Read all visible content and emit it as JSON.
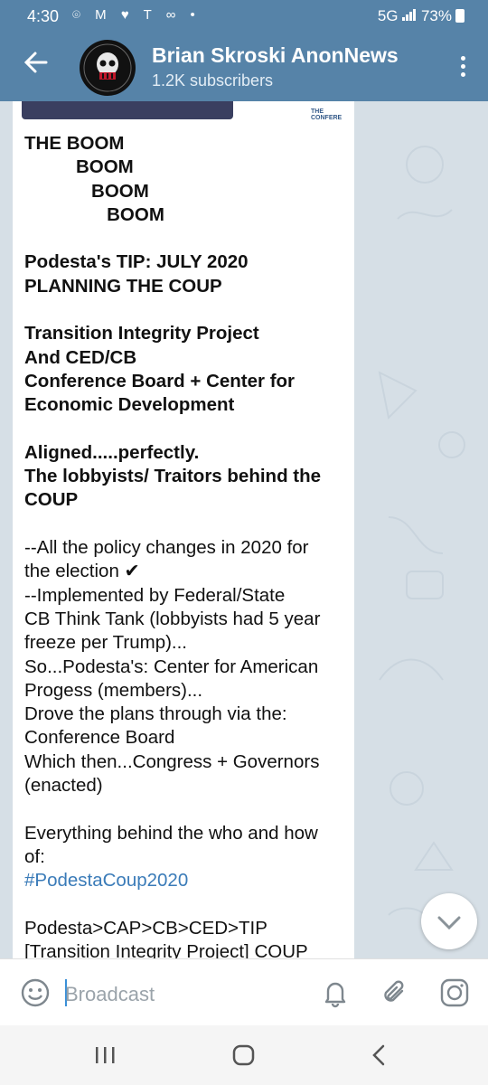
{
  "status_bar": {
    "time": "4:30",
    "left_icons": "⌾ M ♥ T ∞ •",
    "network": "5G",
    "battery": "73%"
  },
  "header": {
    "channel_name": "Brian Skroski AnonNews",
    "subscribers": "1.2K subscribers"
  },
  "media_preview": {
    "label": "THE CONFERE"
  },
  "message": {
    "lines": [
      {
        "text": "THE BOOM",
        "style": "b"
      },
      {
        "text": "          BOOM",
        "style": "b"
      },
      {
        "text": "             BOOM",
        "style": "b"
      },
      {
        "text": "                BOOM",
        "style": "b"
      },
      {
        "text": "",
        "style": ""
      },
      {
        "text": "Podesta's TIP: JULY 2020",
        "style": "b"
      },
      {
        "text": "PLANNING THE COUP",
        "style": "b"
      },
      {
        "text": "",
        "style": ""
      },
      {
        "text": "Transition Integrity Project",
        "style": "b"
      },
      {
        "text": "And CED/CB",
        "style": "b"
      },
      {
        "text": "Conference Board + Center for",
        "style": "b"
      },
      {
        "text": "Economic Development",
        "style": "b"
      },
      {
        "text": "",
        "style": ""
      },
      {
        "text": "Aligned.....perfectly.",
        "style": "b"
      },
      {
        "text": "The lobbyists/ Traitors behind the",
        "style": "b"
      },
      {
        "text": "COUP",
        "style": "b"
      },
      {
        "text": "",
        "style": ""
      },
      {
        "text": "--All the policy changes in 2020 for",
        "style": ""
      },
      {
        "text": "the election ✔",
        "style": ""
      },
      {
        "text": "--Implemented by Federal/State",
        "style": ""
      },
      {
        "text": "CB Think Tank (lobbyists had 5 year",
        "style": ""
      },
      {
        "text": "freeze per Trump)...",
        "style": ""
      },
      {
        "text": "So...Podesta's: Center for American",
        "style": ""
      },
      {
        "text": "Progess (members)...",
        "style": ""
      },
      {
        "text": "Drove the plans through via the:",
        "style": ""
      },
      {
        "text": "Conference Board",
        "style": ""
      },
      {
        "text": "Which then...Congress + Governors",
        "style": ""
      },
      {
        "text": "(enacted)",
        "style": ""
      },
      {
        "text": "",
        "style": ""
      },
      {
        "text": "Everything behind the who and how",
        "style": ""
      },
      {
        "text": "of:",
        "style": ""
      },
      {
        "text": "#PodestaCoup2020",
        "style": "tag"
      },
      {
        "text": "",
        "style": ""
      },
      {
        "text": "Podesta>CAP>CB>CED>TIP",
        "style": ""
      },
      {
        "text": "[Transition Integrity Project] COUP",
        "style": ""
      }
    ]
  },
  "input": {
    "placeholder": "Broadcast"
  },
  "colors": {
    "header": "#5683a8",
    "link": "#3a7bb8",
    "chat_bg": "#d6dfe6"
  },
  "icons": {
    "back": "arrow-left-icon",
    "menu": "more-vertical-icon",
    "emoji": "smiley-icon",
    "bell": "bell-icon",
    "attach": "paperclip-icon",
    "camera": "instagram-camera-icon"
  }
}
